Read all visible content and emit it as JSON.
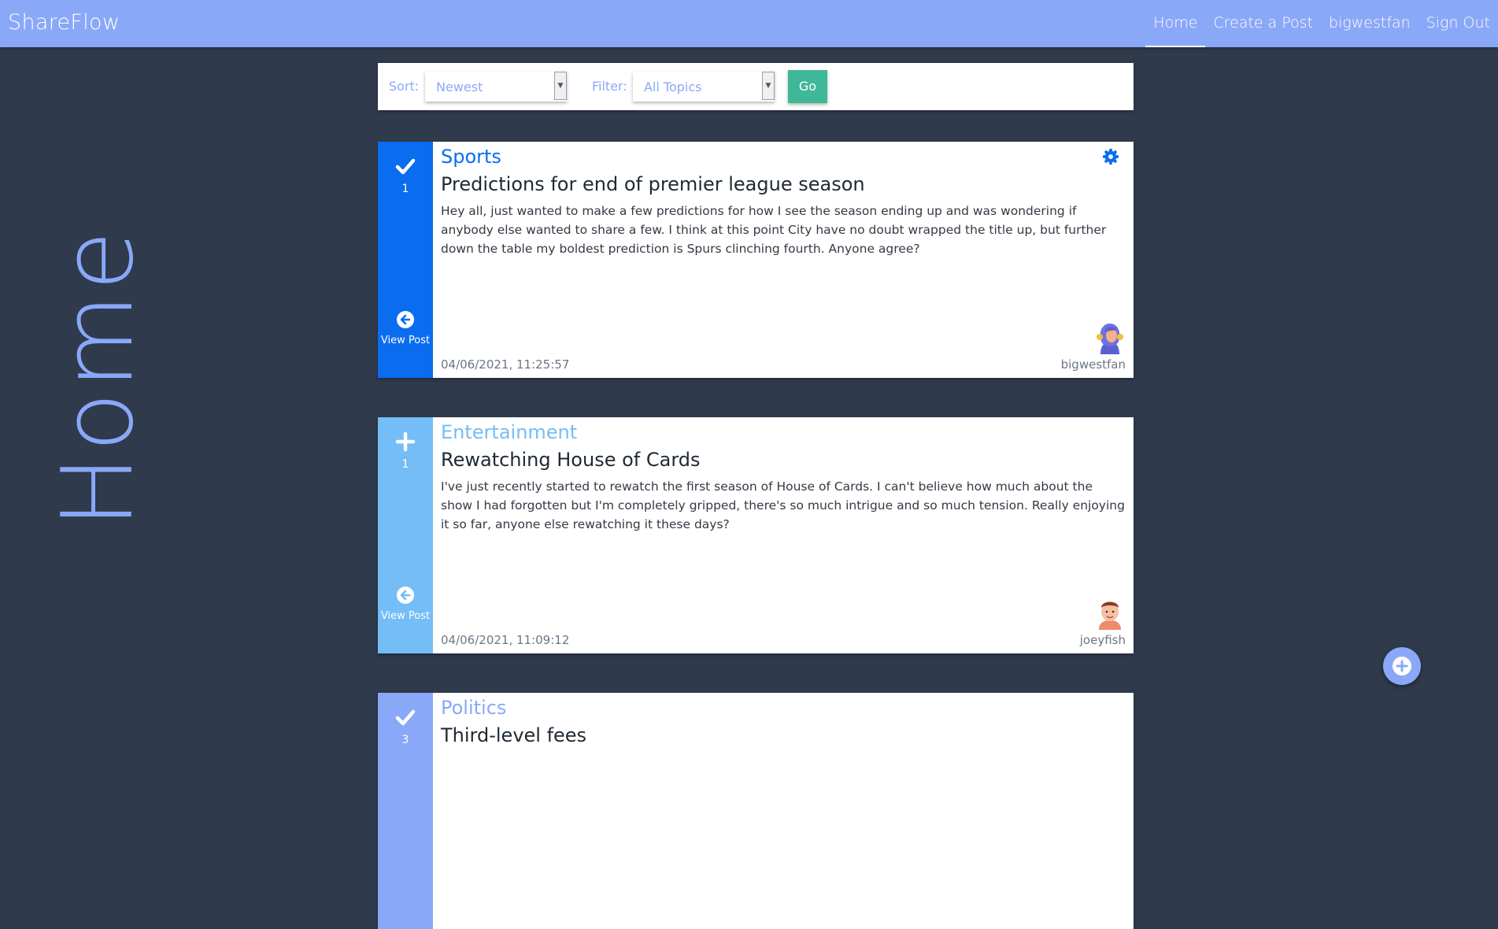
{
  "app": {
    "brand": "ShareFlow"
  },
  "nav": {
    "items": [
      {
        "label": "Home",
        "active": true
      },
      {
        "label": "Create a Post"
      },
      {
        "label": "bigwestfan"
      },
      {
        "label": "Sign Out"
      }
    ]
  },
  "page": {
    "side_title": "Home"
  },
  "filters": {
    "sort_label": "Sort:",
    "sort_value": "Newest",
    "filter_label": "Filter:",
    "filter_value": "All Topics",
    "go_label": "Go"
  },
  "posts": [
    {
      "topic": "Sports",
      "title": "Predictions for end of premier league season",
      "body": "Hey all, just wanted to make a few predictions for how I see the season ending up and was wondering if anybody else wanted to share a few. I think at this point City have no doubt wrapped the title up, but further down the table my boldest prediction is Spurs clinching fourth. Anyone agree?",
      "votes": "1",
      "vote_icon": "check-icon",
      "view_label": "View Post",
      "timestamp": "04/06/2021, 11:25:57",
      "author": "bigwestfan",
      "has_settings": true,
      "color": "#0a6df0"
    },
    {
      "topic": "Entertainment",
      "title": "Rewatching House of Cards",
      "body": "I've just recently started to rewatch the first season of House of Cards. I can't believe how much about the show I had forgotten but I'm completely gripped, there's so much intrigue and so much tension. Really enjoying it so far, anyone else rewatching it these days?",
      "votes": "1",
      "vote_icon": "plus-icon",
      "view_label": "View Post",
      "timestamp": "04/06/2021, 11:09:12",
      "author": "joeyfish",
      "has_settings": false,
      "color": "#74bdf7"
    },
    {
      "topic": "Politics",
      "title": "Third-level fees",
      "votes": "3",
      "vote_icon": "check-icon",
      "color": "#8aa8f8"
    }
  ],
  "fab": {
    "icon": "plus-icon"
  },
  "colors": {
    "navbar": "#8aa8f8",
    "background": "#2f3a4c",
    "go_button": "#3fb89a"
  }
}
